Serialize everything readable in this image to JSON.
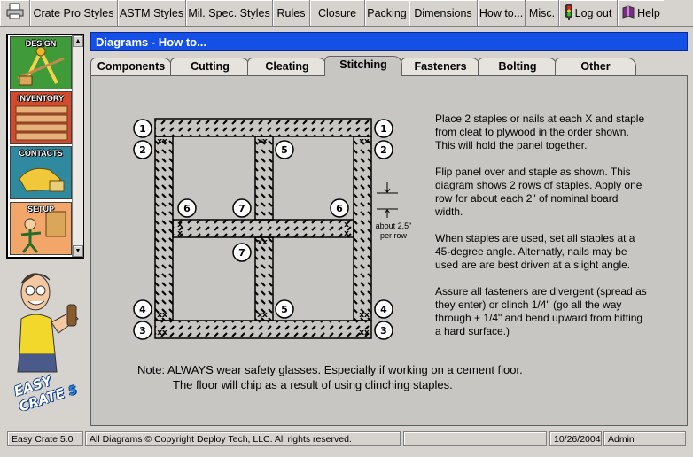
{
  "menubar": {
    "items": [
      {
        "label": "",
        "icon": "printer-icon"
      },
      {
        "label": "Crate Pro Styles"
      },
      {
        "label": "ASTM Styles"
      },
      {
        "label": "Mil. Spec. Styles"
      },
      {
        "label": "Rules"
      },
      {
        "label": "Closure"
      },
      {
        "label": "Packing"
      },
      {
        "label": "Dimensions"
      },
      {
        "label": "How to..."
      },
      {
        "label": "Misc."
      },
      {
        "label": "Log out",
        "icon": "stoplight-icon"
      },
      {
        "label": "Help",
        "icon": "help-book-icon"
      }
    ]
  },
  "nav": {
    "items": [
      {
        "label": "DESIGN"
      },
      {
        "label": "INVENTORY"
      },
      {
        "label": "CONTACTS"
      },
      {
        "label": "SETUP"
      }
    ],
    "logo_text": {
      "line1": "EASY",
      "line2": "CRATE",
      "version": "5"
    }
  },
  "panel": {
    "title": "Diagrams - How to...",
    "tabs": [
      {
        "label": "Components",
        "active": false
      },
      {
        "label": "Cutting",
        "active": false
      },
      {
        "label": "Cleating",
        "active": false
      },
      {
        "label": "Stitching",
        "active": true
      },
      {
        "label": "Fasteners",
        "active": false
      },
      {
        "label": "Bolting",
        "active": false
      },
      {
        "label": "Other",
        "active": false
      }
    ]
  },
  "diagram": {
    "dimension_label_1": "about 2.5\"",
    "dimension_label_2": "per row"
  },
  "instructions": [
    "Place 2 staples or nails at each X and staple from cleat to plywood in the order shown.  This will hold the panel  together.",
    "Flip panel over and staple as shown. This diagram shows 2 rows of staples. Apply one row for about each 2\" of nominal board width.",
    "When staples are used, set all staples at a 45-degree angle. Alternatly, nails may be used are are best driven at a slight angle.",
    "Assure all fasteners are divergent (spread as they enter) or clinch 1/4\" (go all the way through + 1/4\" and bend upward from hitting a hard surface.)"
  ],
  "note": {
    "line1": "Note: ALWAYS wear safety glasses. Especially if working on a cement floor.",
    "line2": "The floor will chip as a result of using clinching staples."
  },
  "status": {
    "app": "Easy Crate 5.0",
    "copyright": "All Diagrams © Copyright Deploy Tech, LLC.  All rights reserved.",
    "empty": "",
    "date": "10/26/2004",
    "user": "Admin"
  },
  "colors": {
    "titlebar": "#1550e6",
    "panel_bg": "#c8c6c2",
    "window_bg": "#d6d3ce"
  }
}
